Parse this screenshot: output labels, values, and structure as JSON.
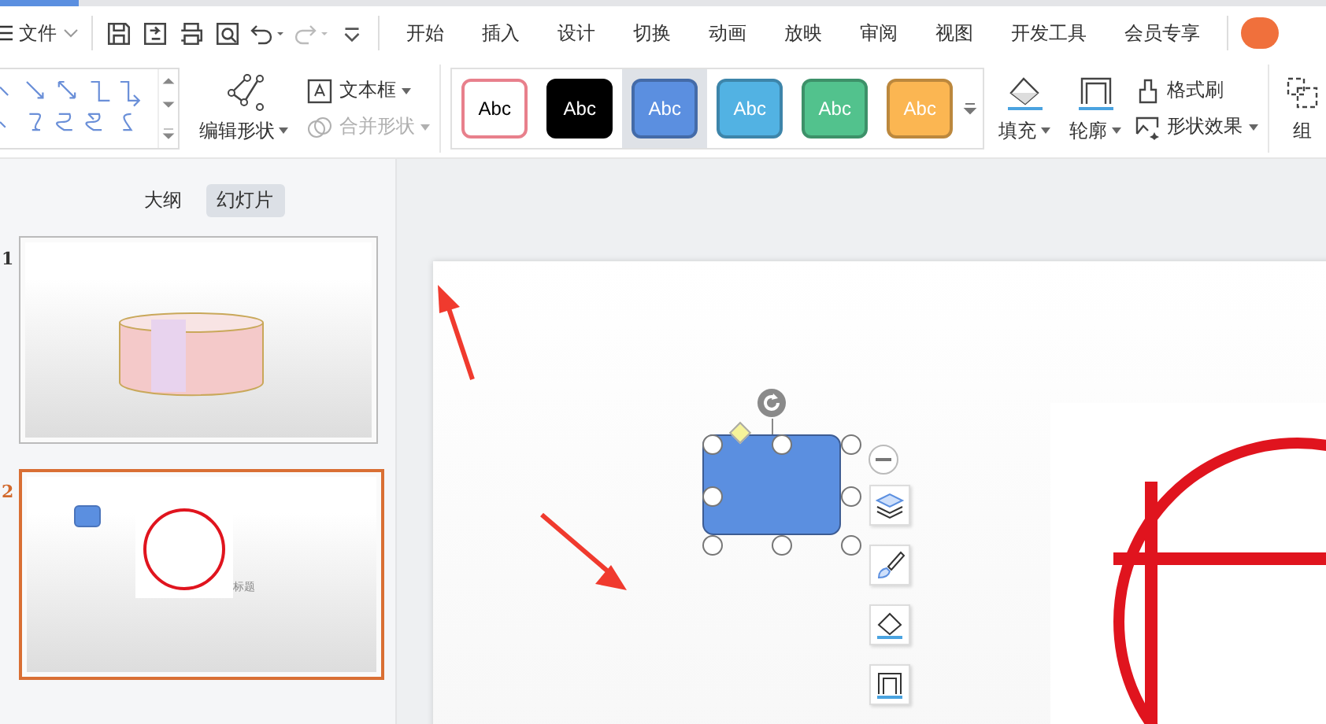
{
  "menu": {
    "file_label": "文件"
  },
  "tabs": [
    {
      "label": "开始",
      "selected": false
    },
    {
      "label": "插入",
      "selected": false
    },
    {
      "label": "设计",
      "selected": false
    },
    {
      "label": "切换",
      "selected": false
    },
    {
      "label": "动画",
      "selected": false
    },
    {
      "label": "放映",
      "selected": false
    },
    {
      "label": "审阅",
      "selected": false
    },
    {
      "label": "视图",
      "selected": false
    },
    {
      "label": "开发工具",
      "selected": false
    },
    {
      "label": "会员专享",
      "selected": false
    }
  ],
  "ribbon": {
    "edit_shape": "编辑形状",
    "text_box": "文本框",
    "merge_shapes": {
      "label": "合并形状",
      "disabled": true
    },
    "styles": [
      {
        "label": "Abc",
        "color": "#ffffff",
        "selected": false
      },
      {
        "label": "Abc",
        "color": "#000000",
        "selected": false
      },
      {
        "label": "Abc",
        "color": "#5b8fe0",
        "selected": true
      },
      {
        "label": "Abc",
        "color": "#52b2e3",
        "selected": false
      },
      {
        "label": "Abc",
        "color": "#52c28d",
        "selected": false
      },
      {
        "label": "Abc",
        "color": "#fbb652",
        "selected": false
      }
    ],
    "fill": "填充",
    "outline": "轮廓",
    "format_painter": "格式刷",
    "shape_effects": "形状效果",
    "group": "组"
  },
  "panel": {
    "tabs": [
      {
        "label": "大纲",
        "selected": false
      },
      {
        "label": "幻灯片",
        "selected": true
      }
    ],
    "slides": [
      {
        "number": "1",
        "kind": "photo",
        "selected": false
      },
      {
        "number": "2",
        "kind": "stamp",
        "selected": true,
        "caption": "标题"
      }
    ]
  }
}
